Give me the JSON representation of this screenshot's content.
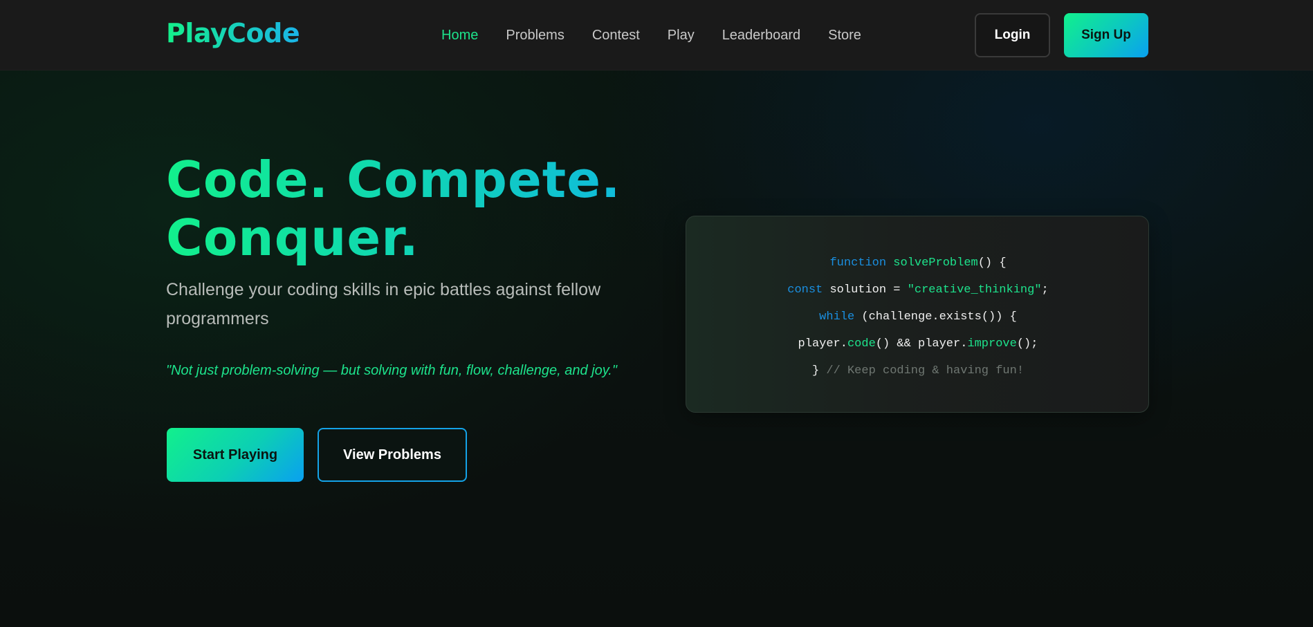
{
  "brand": {
    "logo": "PlayCode"
  },
  "nav": {
    "links": [
      {
        "label": "Home",
        "active": true
      },
      {
        "label": "Problems",
        "active": false
      },
      {
        "label": "Contest",
        "active": false
      },
      {
        "label": "Play",
        "active": false
      },
      {
        "label": "Leaderboard",
        "active": false
      },
      {
        "label": "Store",
        "active": false
      }
    ],
    "login_label": "Login",
    "signup_label": "Sign Up"
  },
  "hero": {
    "title_line1": "Code. Compete.",
    "title_line2": "Conquer.",
    "subtitle": "Challenge your coding skills in epic battles against fellow programmers",
    "quote": "\"Not just problem-solving — but solving with fun, flow, challenge, and joy.\"",
    "start_label": "Start Playing",
    "view_label": "View Problems"
  },
  "code": {
    "line1": {
      "kw": "function",
      "fn": "solveProblem",
      "rest": "() {"
    },
    "line2": {
      "kw": "const",
      "mid": " solution = ",
      "str": "\"creative_thinking\"",
      "rest": ";"
    },
    "line3": {
      "kw": "while",
      "rest": " (challenge.exists()) {"
    },
    "line4": {
      "a": "player.",
      "fn1": "code",
      "b": "() && player.",
      "fn2": "improve",
      "c": "();"
    },
    "line5": {
      "a": "} ",
      "cm": "// Keep coding & having fun!"
    }
  },
  "colors": {
    "accent_green": "#1de38c",
    "accent_blue": "#14a3e8",
    "nav_bg": "#1a1a1a",
    "page_bg": "#0b110e"
  }
}
